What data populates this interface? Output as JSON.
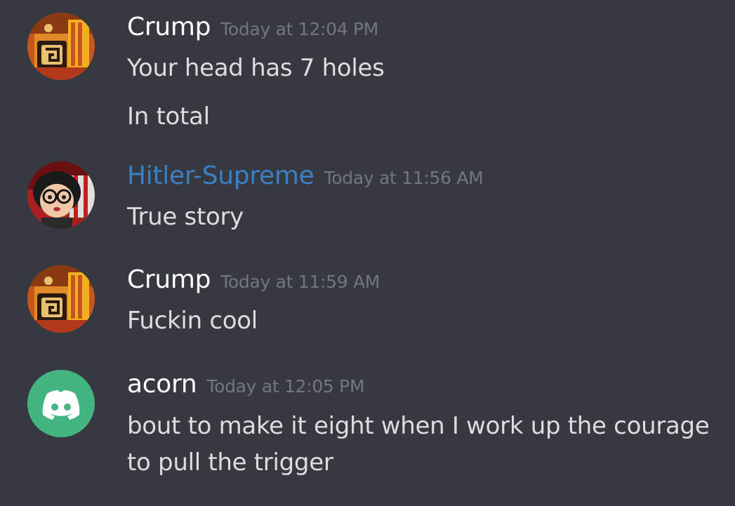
{
  "messages": [
    {
      "username": "Crump",
      "timestamp": "Today at 12:04 PM",
      "lines": [
        "Your head has 7 holes",
        "In total"
      ]
    },
    {
      "username": "Hitler-Supreme",
      "timestamp": "Today at 11:56 AM",
      "lines": [
        "True story"
      ]
    },
    {
      "username": "Crump",
      "timestamp": "Today at 11:59 AM",
      "lines": [
        "Fuckin cool"
      ]
    },
    {
      "username": "acorn",
      "timestamp": "Today at 12:05 PM",
      "lines": [
        "bout to make it eight when I work up the courage",
        "to pull the trigger"
      ]
    }
  ],
  "colors": {
    "background": "#36393f",
    "username_default": "#ffffff",
    "username_blue": "#3b7fc4",
    "timestamp": "#72767d",
    "message_text": "#dcddde",
    "discord_avatar": "#43b581"
  },
  "icons": [
    "crump-avatar",
    "character-avatar",
    "discord-logo-icon"
  ]
}
